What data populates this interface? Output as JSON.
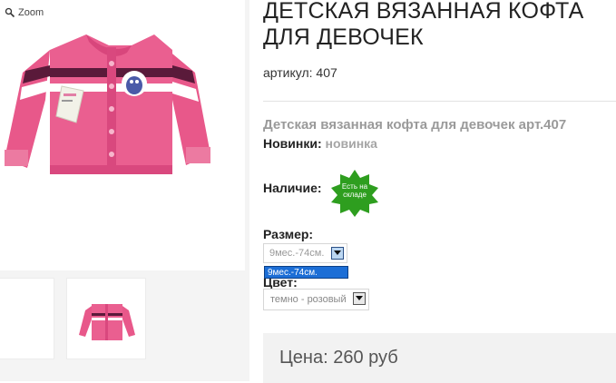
{
  "gallery": {
    "zoom_label": "Zoom",
    "main_image_icon": "pink-knit-cardigan-photo",
    "thumbnails": [
      "cardigan-thumbnail-white",
      "pink-knit-cardigan-thumbnail"
    ]
  },
  "product": {
    "title": "Детская вязанная кофта для девочек",
    "article": "артикул: 407",
    "description_title": "Детская вязанная кофта для девочек арт.407",
    "new_label": "Новинки:",
    "new_value": "новинка",
    "availability_label": "Наличие:",
    "stock_badge": "Есть на складе",
    "size_label": "Размер:",
    "size_selected": "9мес.-74см.",
    "size_options": [
      "9мес.-74см."
    ],
    "color_label": "Цвет:",
    "color_selected": "темно - розовый",
    "price": "Цена: 260 руб"
  },
  "colors": {
    "stock_badge": "#2e9e1f",
    "dropdown_highlight": "#1c6ed6",
    "cardigan_pink": "#e8588a"
  }
}
